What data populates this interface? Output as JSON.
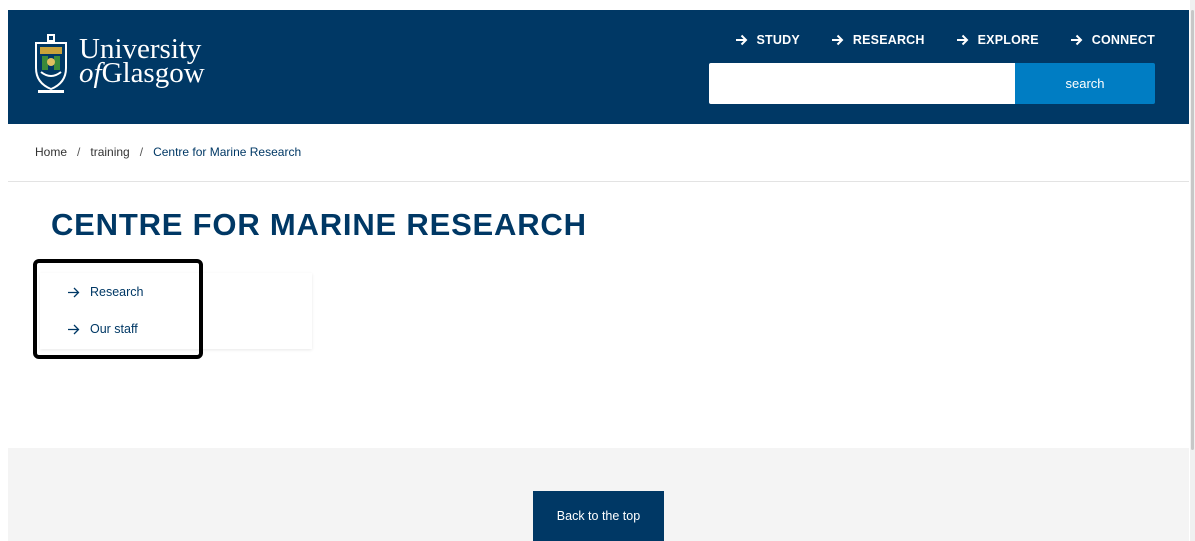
{
  "header": {
    "logo_line1": "University",
    "logo_line2_italic": "of",
    "logo_line2_rest": "Glasgow",
    "logo_icon": "university-crest-icon",
    "nav": [
      {
        "label": "STUDY",
        "icon": "arrow-right-icon"
      },
      {
        "label": "RESEARCH",
        "icon": "arrow-right-icon"
      },
      {
        "label": "EXPLORE",
        "icon": "arrow-right-icon"
      },
      {
        "label": "CONNECT",
        "icon": "arrow-right-icon"
      }
    ],
    "search": {
      "value": "",
      "placeholder": "",
      "button_label": "search"
    }
  },
  "breadcrumb": {
    "items": [
      "Home",
      "training",
      "Centre for Marine Research"
    ],
    "separator": "/"
  },
  "page_title": "CENTRE FOR MARINE RESEARCH",
  "subnav": {
    "items": [
      {
        "label": "Research",
        "icon": "arrow-right-icon"
      },
      {
        "label": "Our staff",
        "icon": "arrow-right-icon"
      }
    ]
  },
  "footer": {
    "back_to_top_label": "Back to the top"
  },
  "colors": {
    "brand_navy": "#003865",
    "accent_blue": "#007dc3",
    "footer_bg": "#f4f4f4",
    "highlight_border": "#000000"
  }
}
